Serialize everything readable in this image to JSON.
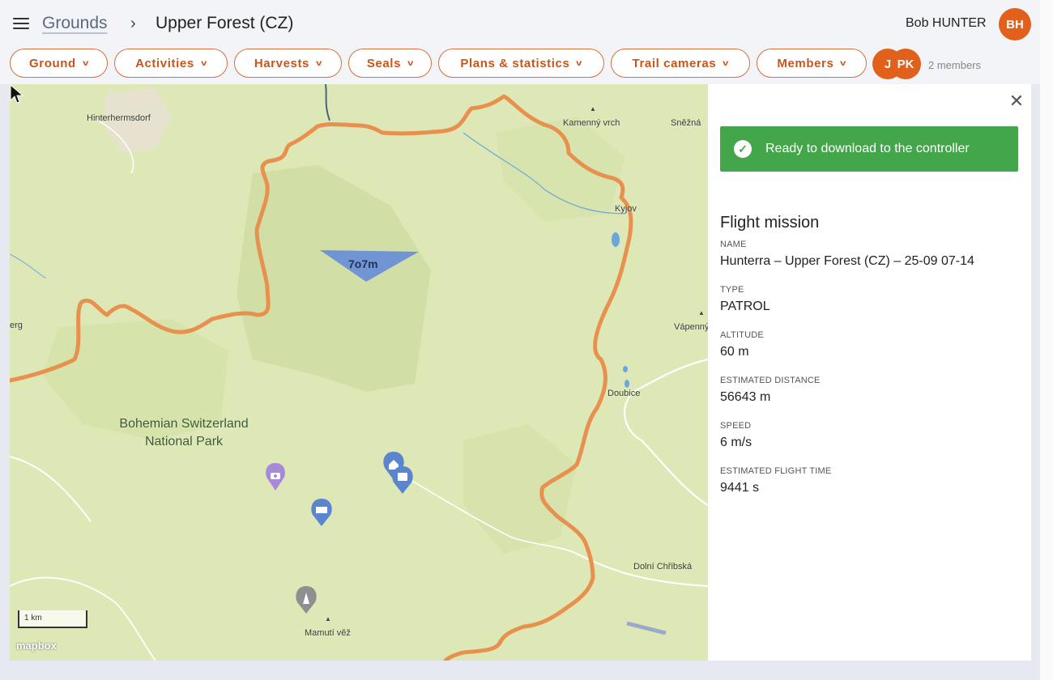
{
  "header": {
    "breadcrumb_root": "Grounds",
    "breadcrumb_sep": "›",
    "breadcrumb_current": "Upper Forest (CZ)",
    "user_name": "Bob HUNTER",
    "user_initials": "BH"
  },
  "menu": {
    "items": [
      {
        "label": "Ground"
      },
      {
        "label": "Activities"
      },
      {
        "label": "Harvests"
      },
      {
        "label": "Seals"
      },
      {
        "label": "Plans & statistics"
      },
      {
        "label": "Trail cameras"
      },
      {
        "label": "Members"
      }
    ],
    "member_avatars": [
      "J",
      "PK"
    ],
    "members_count": "2 members"
  },
  "map": {
    "places": [
      "Hinterhermsdorf",
      "Kamenný vrch",
      "Sněžná",
      "Kyjov",
      "erg",
      "Vápenný",
      "Doubice",
      "Dolní Chřibská",
      "Mamutí věž"
    ],
    "park_label_line1": "Bohemian Switzerland",
    "park_label_line2": "National Park",
    "zone_label": "7o7m",
    "scale_label": "1 km",
    "attribution": "mapbox",
    "border_color": "#e8914f",
    "zone_color": "#6b8fd6"
  },
  "panel": {
    "status": "Ready to download to the controller",
    "status_color": "#43a64a",
    "title": "Flight mission",
    "fields": [
      {
        "label": "NAME",
        "value": "Hunterra – Upper Forest (CZ) – 25-09 07-14"
      },
      {
        "label": "TYPE",
        "value": "PATROL"
      },
      {
        "label": "ALTITUDE",
        "value": "60 m"
      },
      {
        "label": "ESTIMATED DISTANCE",
        "value": "56643 m"
      },
      {
        "label": "SPEED",
        "value": "6 m/s"
      },
      {
        "label": "ESTIMATED FLIGHT TIME",
        "value": "9441 s"
      }
    ]
  }
}
